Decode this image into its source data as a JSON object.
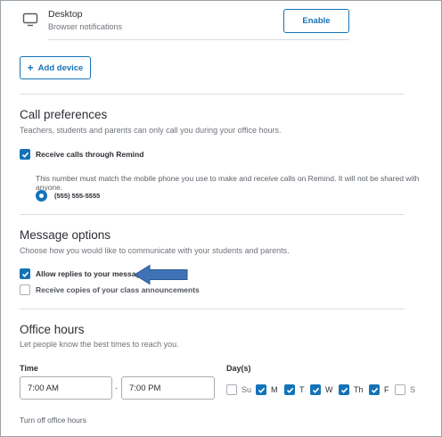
{
  "desktop": {
    "icon": "monitor-icon",
    "title": "Desktop",
    "subtitle": "Browser notifications",
    "enable_label": "Enable"
  },
  "add_device": {
    "icon": "plus-icon",
    "label": "Add device"
  },
  "call_preferences": {
    "title": "Call preferences",
    "description": "Teachers, students and parents can only call you during your office hours.",
    "receive_calls": {
      "label": "Receive calls through Remind",
      "checked": true
    },
    "note": "This number must match the mobile phone you use to make and receive calls on Remind. It will not be shared with anyone.",
    "phone": {
      "value": "(555) 555-5555",
      "selected": true
    }
  },
  "message_options": {
    "title": "Message options",
    "description": "Choose how you would like to communicate with your students and parents.",
    "allow_replies": {
      "label": "Allow replies to your messages",
      "checked": true
    },
    "receive_copies": {
      "label": "Receive copies of your class announcements",
      "checked": false
    },
    "annotation": "arrow-left-icon"
  },
  "office_hours": {
    "title": "Office hours",
    "description": "Let people know the best times to reach you.",
    "time_label": "Time",
    "start_time": "7:00 AM",
    "separator": "-",
    "end_time": "7:00 PM",
    "days_label": "Day(s)",
    "days": [
      {
        "label": "Su",
        "checked": false
      },
      {
        "label": "M",
        "checked": true
      },
      {
        "label": "T",
        "checked": true
      },
      {
        "label": "W",
        "checked": true
      },
      {
        "label": "Th",
        "checked": true
      },
      {
        "label": "F",
        "checked": true
      },
      {
        "label": "S",
        "checked": false
      }
    ],
    "turn_off_label": "Turn off office hours"
  },
  "colors": {
    "accent": "#1473b8",
    "arrow": "#3f72b6",
    "divider": "#dadde1"
  }
}
